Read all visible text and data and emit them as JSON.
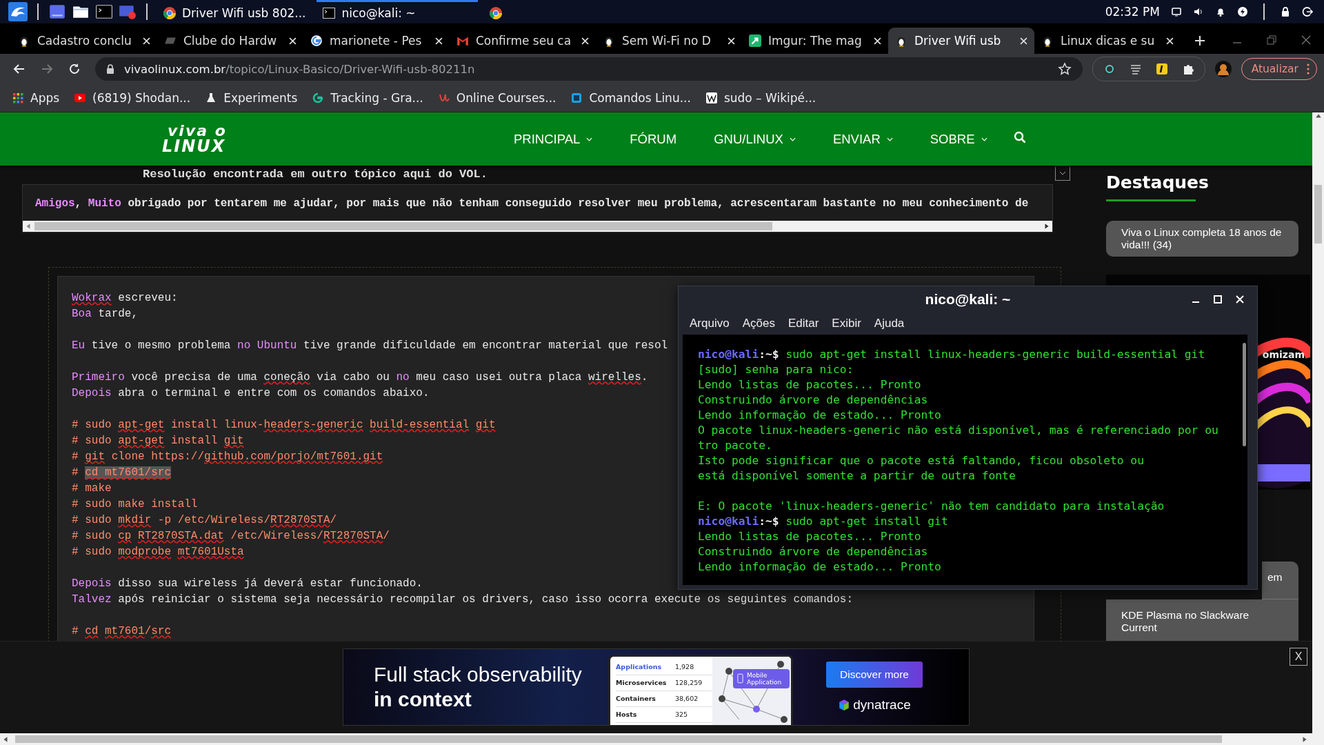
{
  "panel": {
    "tasks": [
      {
        "title": "Driver Wifi usb 802...",
        "kind": "browser",
        "selected": false
      },
      {
        "title": "nico@kali: ~",
        "kind": "terminal",
        "selected": true
      },
      {
        "kind": "browser",
        "selected": false
      }
    ],
    "clock": "02:32 PM"
  },
  "browser": {
    "tabs": [
      {
        "title": "Cadastro conclu",
        "kind": "penguin",
        "selected": false
      },
      {
        "title": "Clube do Hardw",
        "kind": "clube",
        "selected": false
      },
      {
        "title": "marionete - Pes",
        "kind": "google",
        "selected": false
      },
      {
        "title": "Confirme seu ca",
        "kind": "mail",
        "selected": false
      },
      {
        "title": "Sem Wi-Fi no D",
        "kind": "penguin",
        "selected": false
      },
      {
        "title": "Imgur: The mag",
        "kind": "imgur",
        "selected": false
      },
      {
        "title": "Driver Wifi usb",
        "kind": "penguin",
        "selected": true
      },
      {
        "title": "Linux dicas e su",
        "kind": "penguin",
        "selected": false
      }
    ],
    "url": {
      "host": "vivaolinux.com.br",
      "path": "/topico/Linux-Basico/Driver-Wifi-usb-80211n"
    },
    "update_button": "Atualizar",
    "bookmarks": [
      {
        "label": "Apps",
        "kind": "apps"
      },
      {
        "label": "(6819) Shodan...",
        "kind": "video"
      },
      {
        "label": "Experiments",
        "kind": "flask"
      },
      {
        "label": "Tracking - Gra...",
        "kind": "g"
      },
      {
        "label": "Online Courses...",
        "kind": "u"
      },
      {
        "label": "Comandos Linu...",
        "kind": "square"
      },
      {
        "label": "sudo – Wikipé...",
        "kind": "w"
      }
    ]
  },
  "site": {
    "logo": [
      "viva o",
      "LINUX"
    ],
    "nav": [
      {
        "label": "PRINCIPAL",
        "has_menu": true
      },
      {
        "label": "FÓRUM",
        "has_menu": false
      },
      {
        "label": "GNU/LINUX",
        "has_menu": true
      },
      {
        "label": "ENVIAR",
        "has_menu": true
      },
      {
        "label": "SOBRE",
        "has_menu": true
      }
    ],
    "cut_heading": "Resolução encontrada em outro tópico aqui do VOL.",
    "code_box": [
      {
        "text": "Amigos",
        "kind": "keyword",
        "misspelled": false
      },
      {
        "text": ", ",
        "kind": "plain",
        "misspelled": false
      },
      {
        "text": "Muito",
        "kind": "keyword",
        "misspelled": false
      },
      {
        "text": " obrigado por tentarem me ajudar, por mais que não tenham conseguido resolver meu problema, acrescentaram bastante no meu conhecimento de ",
        "kind": "plain",
        "misspelled": false
      }
    ],
    "quote": [
      {
        "kind": "text",
        "segments": [
          {
            "text": "Wokrax",
            "kind": "keyword",
            "misspelled": true
          },
          {
            "text": " escreveu:",
            "kind": "plain",
            "misspelled": false
          }
        ]
      },
      {
        "kind": "text",
        "segments": [
          {
            "text": "Boa",
            "kind": "keyword",
            "misspelled": false
          },
          {
            "text": " tarde,",
            "kind": "plain",
            "misspelled": false
          }
        ]
      },
      {
        "kind": "blank"
      },
      {
        "kind": "text",
        "segments": [
          {
            "text": "Eu",
            "kind": "keyword",
            "misspelled": false
          },
          {
            "text": " tive o mesmo problema ",
            "kind": "plain",
            "misspelled": false
          },
          {
            "text": "no Ubuntu",
            "kind": "keyword",
            "misspelled": false
          },
          {
            "text": " tive grande dificuldade em encontrar material que resol",
            "kind": "plain",
            "misspelled": false
          }
        ]
      },
      {
        "kind": "blank"
      },
      {
        "kind": "text",
        "segments": [
          {
            "text": "Primeiro",
            "kind": "keyword",
            "misspelled": false
          },
          {
            "text": " você precisa de uma ",
            "kind": "plain",
            "misspelled": false
          },
          {
            "text": "coneção",
            "kind": "plain",
            "misspelled": true
          },
          {
            "text": " via cabo ou ",
            "kind": "plain",
            "misspelled": false
          },
          {
            "text": "no",
            "kind": "keyword",
            "misspelled": false
          },
          {
            "text": " meu caso usei outra placa ",
            "kind": "plain",
            "misspelled": false
          },
          {
            "text": "wirelles",
            "kind": "plain",
            "misspelled": true
          },
          {
            "text": ".",
            "kind": "plain",
            "misspelled": false
          }
        ]
      },
      {
        "kind": "text",
        "segments": [
          {
            "text": "Depois",
            "kind": "keyword",
            "misspelled": false
          },
          {
            "text": " abra o terminal e entre com os comandos abaixo.",
            "kind": "plain",
            "misspelled": false
          }
        ]
      },
      {
        "kind": "blank"
      },
      {
        "kind": "text",
        "segments": [
          {
            "text": "# sudo ",
            "kind": "command",
            "misspelled": false
          },
          {
            "text": "apt-get",
            "kind": "command",
            "misspelled": true
          },
          {
            "text": " install linux-",
            "kind": "command",
            "misspelled": false
          },
          {
            "text": "headers-generic",
            "kind": "command",
            "misspelled": true
          },
          {
            "text": " build-essential",
            "kind": "command",
            "misspelled": true
          },
          {
            "text": " git",
            "kind": "command",
            "misspelled": true
          }
        ]
      },
      {
        "kind": "text",
        "segments": [
          {
            "text": "# sudo ",
            "kind": "command",
            "misspelled": false
          },
          {
            "text": "apt-get",
            "kind": "command",
            "misspelled": true
          },
          {
            "text": " install ",
            "kind": "command",
            "misspelled": false
          },
          {
            "text": "git",
            "kind": "command",
            "misspelled": true
          }
        ]
      },
      {
        "kind": "text",
        "segments": [
          {
            "text": "# ",
            "kind": "command",
            "misspelled": false
          },
          {
            "text": "git",
            "kind": "command",
            "misspelled": true
          },
          {
            "text": " clone https://",
            "kind": "command",
            "misspelled": false
          },
          {
            "text": "github.com/porjo/mt7601.git",
            "kind": "command",
            "misspelled": true
          }
        ]
      },
      {
        "kind": "text",
        "segments": [
          {
            "text": "# ",
            "kind": "command",
            "misspelled": false
          },
          {
            "text": "cd mt7601/src",
            "kind": "command-selected",
            "misspelled": true
          }
        ]
      },
      {
        "kind": "text",
        "segments": [
          {
            "text": "# make",
            "kind": "command",
            "misspelled": false
          }
        ]
      },
      {
        "kind": "text",
        "segments": [
          {
            "text": "# sudo make install",
            "kind": "command",
            "misspelled": false
          }
        ]
      },
      {
        "kind": "text",
        "segments": [
          {
            "text": "# sudo ",
            "kind": "command",
            "misspelled": false
          },
          {
            "text": "mkdir",
            "kind": "command",
            "misspelled": true
          },
          {
            "text": " -p /etc/Wireless/",
            "kind": "command",
            "misspelled": false
          },
          {
            "text": "RT2870STA",
            "kind": "command",
            "misspelled": true
          },
          {
            "text": "/",
            "kind": "command",
            "misspelled": false
          }
        ]
      },
      {
        "kind": "text",
        "segments": [
          {
            "text": "# sudo ",
            "kind": "command",
            "misspelled": false
          },
          {
            "text": "cp",
            "kind": "command",
            "misspelled": true
          },
          {
            "text": " RT2870STA.dat",
            "kind": "command",
            "misspelled": true
          },
          {
            "text": " /etc/Wireless/",
            "kind": "command",
            "misspelled": false
          },
          {
            "text": "RT2870STA",
            "kind": "command",
            "misspelled": true
          },
          {
            "text": "/",
            "kind": "command",
            "misspelled": false
          }
        ]
      },
      {
        "kind": "text",
        "segments": [
          {
            "text": "# sudo ",
            "kind": "command",
            "misspelled": false
          },
          {
            "text": "modprobe",
            "kind": "command",
            "misspelled": true
          },
          {
            "text": " mt7601Usta",
            "kind": "command",
            "misspelled": true
          }
        ]
      },
      {
        "kind": "blank"
      },
      {
        "kind": "text",
        "segments": [
          {
            "text": "Depois",
            "kind": "keyword",
            "misspelled": false
          },
          {
            "text": " disso sua wireless já deverá estar funcionado.",
            "kind": "plain",
            "misspelled": false
          }
        ]
      },
      {
        "kind": "text",
        "segments": [
          {
            "text": "Talvez",
            "kind": "keyword",
            "misspelled": false
          },
          {
            "text": " após reiniciar o sistema seja necessário recompilar os drivers, caso isso ocorra execute os seguintes comandos:",
            "kind": "plain",
            "misspelled": false
          }
        ]
      },
      {
        "kind": "blank"
      },
      {
        "kind": "text",
        "segments": [
          {
            "text": "# ",
            "kind": "command",
            "misspelled": false
          },
          {
            "text": "cd",
            "kind": "command",
            "misspelled": true
          },
          {
            "text": " mt7601",
            "kind": "command",
            "misspelled": true
          },
          {
            "text": "/",
            "kind": "command",
            "misspelled": false
          },
          {
            "text": "src",
            "kind": "command",
            "misspelled": true
          }
        ]
      }
    ],
    "sidebar": {
      "title": "Destaques",
      "highlights": [
        "Viva o Linux completa 18 anos de vida!!! (34)"
      ],
      "ad_fragment": "omizam",
      "articles": [
        "em",
        "KDE Plasma no Slackware Current"
      ]
    }
  },
  "terminal": {
    "title": "nico@kali: ~",
    "menu": [
      "Arquivo",
      "Ações",
      "Editar",
      "Exibir",
      "Ajuda"
    ],
    "lines": [
      {
        "kind": "prompt",
        "user": "nico@kali",
        "path": ":~$",
        "command": " sudo apt-get install linux-headers-generic build-essential git"
      },
      {
        "kind": "output",
        "text": "[sudo] senha para nico:"
      },
      {
        "kind": "output",
        "text": "Lendo listas de pacotes... Pronto"
      },
      {
        "kind": "output",
        "text": "Construindo árvore de dependências"
      },
      {
        "kind": "output",
        "text": "Lendo informação de estado... Pronto"
      },
      {
        "kind": "output",
        "text": "O pacote linux-headers-generic não está disponível, mas é referenciado por ou"
      },
      {
        "kind": "output",
        "text": "tro pacote."
      },
      {
        "kind": "output",
        "text": "Isto pode significar que o pacote está faltando, ficou obsoleto ou"
      },
      {
        "kind": "output",
        "text": "está disponível somente a partir de outra fonte"
      },
      {
        "kind": "blank"
      },
      {
        "kind": "output",
        "text": "E: O pacote 'linux-headers-generic' não tem candidato para instalação"
      },
      {
        "kind": "prompt",
        "user": "nico@kali",
        "path": ":~$",
        "command": " sudo apt-get install git"
      },
      {
        "kind": "output",
        "text": "Lendo listas de pacotes... Pronto"
      },
      {
        "kind": "output",
        "text": "Construindo árvore de dependências"
      },
      {
        "kind": "output",
        "text": "Lendo informação de estado... Pronto"
      }
    ]
  },
  "ad": {
    "headline": "Full stack observability",
    "headline_bold": "in context",
    "table": [
      {
        "label": "Applications",
        "value": "1,928"
      },
      {
        "label": "Microservices",
        "value": "128,259"
      },
      {
        "label": "Containers",
        "value": "38,602"
      },
      {
        "label": "Hosts",
        "value": "325"
      }
    ],
    "bubble": "Mobile Application",
    "button": "Discover more",
    "brand": "dynatrace",
    "close": "X"
  }
}
